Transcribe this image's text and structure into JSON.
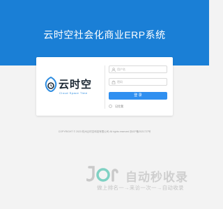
{
  "header": {
    "title": "云时空社会化商业ERP系统"
  },
  "brand": {
    "name": "云时空",
    "subtitle": "Cloud Space Time"
  },
  "login": {
    "username_placeholder": "用户名",
    "password_placeholder": "密码",
    "submit_label": "登 录",
    "remember_label": "记住我"
  },
  "footer": {
    "copyright": "COPYRIGHT © 2023 杭州云时空科技有限公司 All rights reserved 浙ICP备2021727号"
  },
  "watermark": {
    "main": "自动秒收录",
    "sub": "做上排名一→来访一次一→自动收录"
  },
  "colors": {
    "hero": "#1a7fd6",
    "button": "#2f8ff0",
    "background": "#f3f3f3",
    "brand_blue": "#2d8ce0"
  },
  "icons": {
    "user": "user-icon",
    "lock": "lock-icon",
    "brand": "cloud-clock-logo-icon",
    "watermark": "watermark-logo-icon"
  }
}
